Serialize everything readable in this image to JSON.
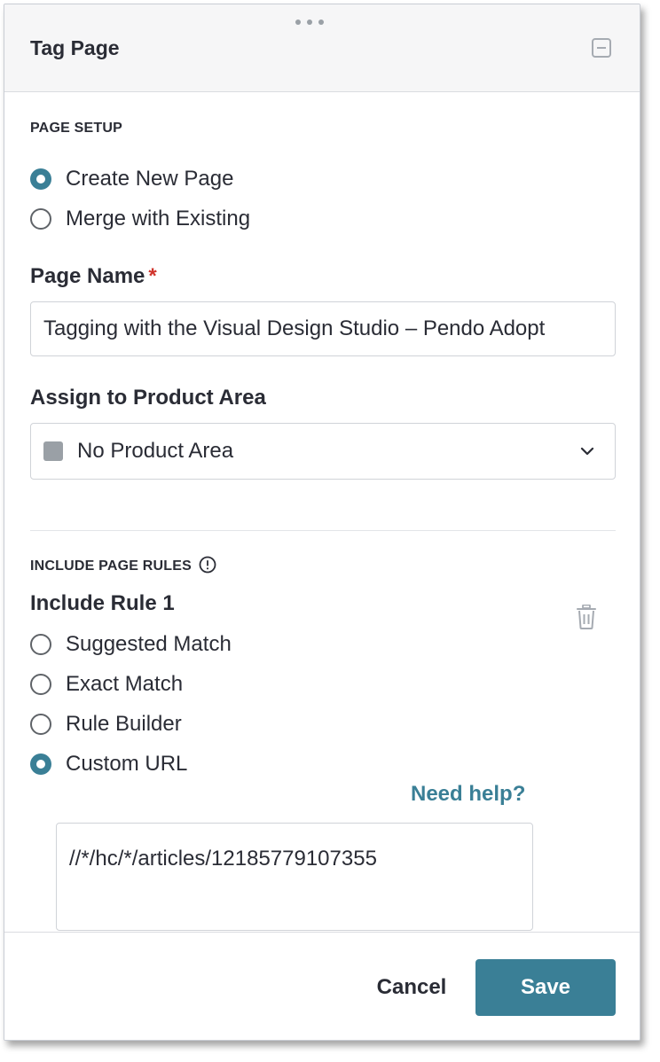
{
  "header": {
    "title": "Tag Page"
  },
  "page_setup": {
    "section_label": "PAGE SETUP",
    "options": [
      {
        "label": "Create New Page",
        "checked": true
      },
      {
        "label": "Merge with Existing",
        "checked": false
      }
    ]
  },
  "page_name": {
    "label": "Page Name",
    "required_marker": "*",
    "value": "Tagging with the Visual Design Studio – Pendo Adopt"
  },
  "product_area": {
    "label": "Assign to Product Area",
    "selected": "No Product Area",
    "swatch_color": "#9aa0a6"
  },
  "include_rules": {
    "section_label": "INCLUDE PAGE RULES",
    "rule_title": "Include Rule 1",
    "options": [
      {
        "label": "Suggested Match",
        "checked": false
      },
      {
        "label": "Exact Match",
        "checked": false
      },
      {
        "label": "Rule Builder",
        "checked": false
      },
      {
        "label": "Custom URL",
        "checked": true
      }
    ],
    "help_link": "Need help?",
    "custom_url": "//*/hc/*/articles/12185779107355"
  },
  "footer": {
    "cancel_label": "Cancel",
    "save_label": "Save"
  },
  "colors": {
    "accent": "#3a7f96",
    "required": "#d0342c"
  },
  "icons": {
    "drag": "drag-handle-icon",
    "minimize": "minimize-icon",
    "info": "info-icon",
    "trash": "trash-icon",
    "chevron": "chevron-down-icon"
  }
}
